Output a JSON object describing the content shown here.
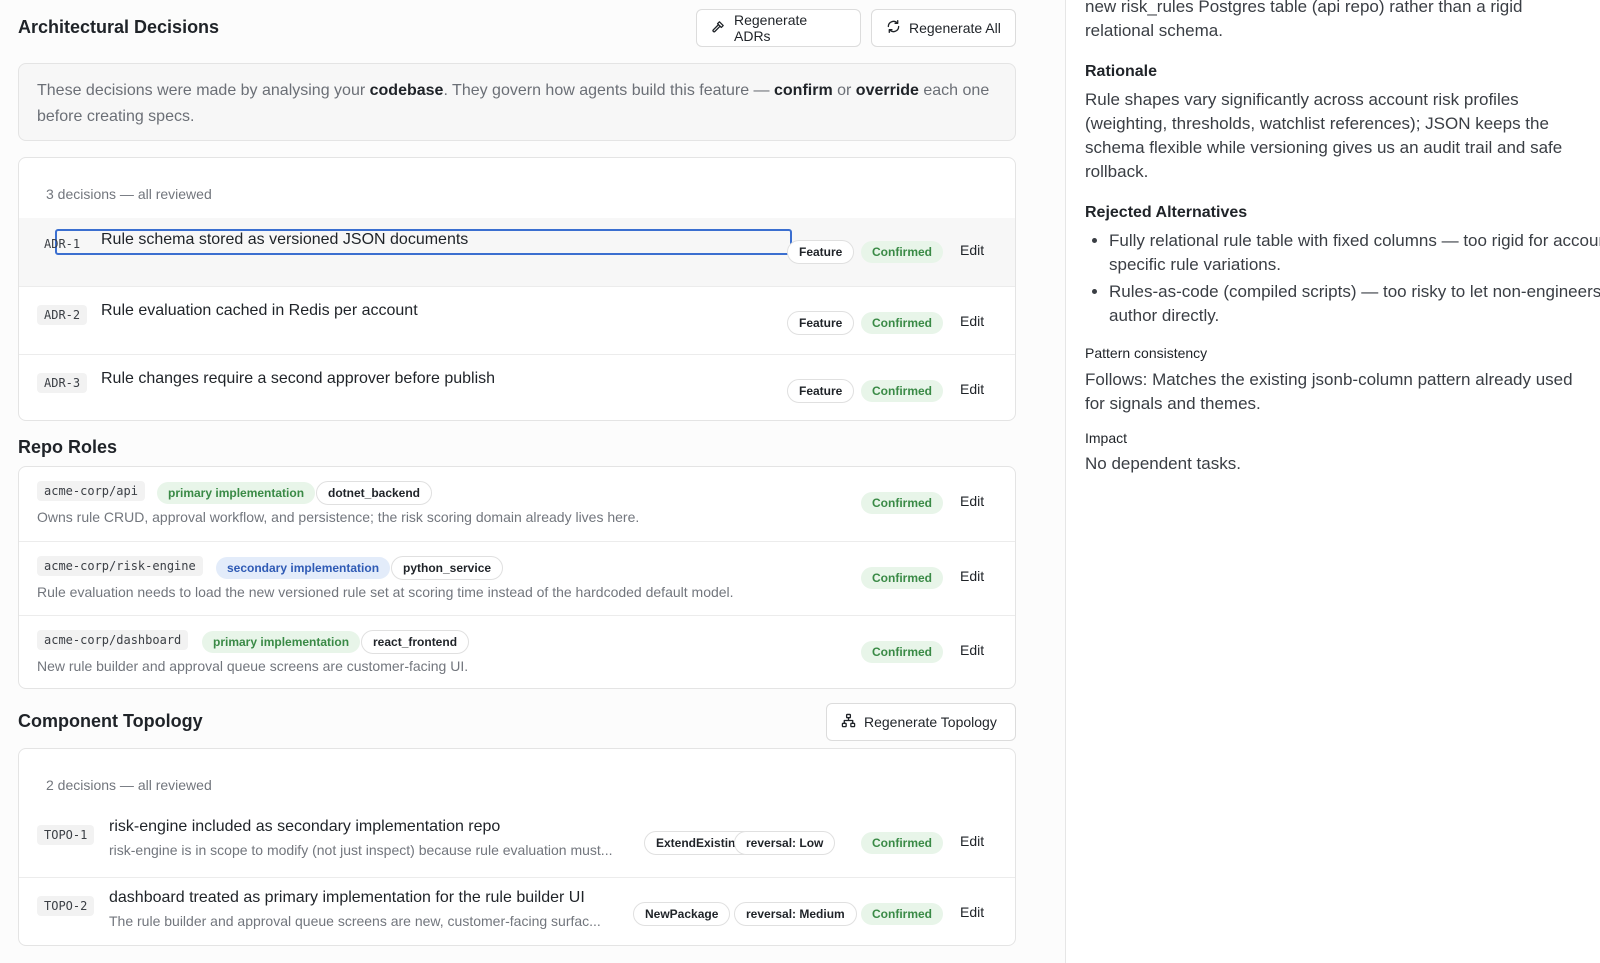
{
  "main": {
    "adr_section": {
      "title": "Architectural Decisions",
      "regen_adrs_label": "Regenerate ADRs",
      "regen_all_label": "Regenerate All",
      "info": {
        "t1": "These decisions were made by analysing your ",
        "b1": "codebase",
        "t2": ". They govern how agents build this feature — ",
        "b2": "confirm",
        "t3": " or ",
        "b3": "override",
        "t4": " each one before creating specs."
      },
      "count_text": "3 decisions — all reviewed",
      "rows": [
        {
          "id": "ADR-1",
          "title": "Rule schema stored as versioned JSON documents",
          "tag": "Feature",
          "status": "Confirmed",
          "edit": "Edit"
        },
        {
          "id": "ADR-2",
          "title": "Rule evaluation cached in Redis per account",
          "tag": "Feature",
          "status": "Confirmed",
          "edit": "Edit"
        },
        {
          "id": "ADR-3",
          "title": "Rule changes require a second approver before publish",
          "tag": "Feature",
          "status": "Confirmed",
          "edit": "Edit"
        }
      ]
    },
    "repo_section": {
      "title": "Repo Roles",
      "rows": [
        {
          "repo": "acme-corp/api",
          "role": "primary implementation",
          "stack": "dotnet_backend",
          "desc": "Owns rule CRUD, approval workflow, and persistence; the risk scoring domain already lives here.",
          "status": "Confirmed",
          "edit": "Edit"
        },
        {
          "repo": "acme-corp/risk-engine",
          "role": "secondary implementation",
          "stack": "python_service",
          "desc": "Rule evaluation needs to load the new versioned rule set at scoring time instead of the hardcoded default model.",
          "status": "Confirmed",
          "edit": "Edit"
        },
        {
          "repo": "acme-corp/dashboard",
          "role": "primary implementation",
          "stack": "react_frontend",
          "desc": "New rule builder and approval queue screens are customer-facing UI.",
          "status": "Confirmed",
          "edit": "Edit"
        }
      ]
    },
    "topology_section": {
      "title": "Component Topology",
      "regen_label": "Regenerate Topology",
      "count_text": "2 decisions — all reviewed",
      "rows": [
        {
          "id": "TOPO-1",
          "title": "risk-engine included as secondary implementation repo",
          "sub": "risk-engine is in scope to modify (not just inspect) because rule evaluation must...",
          "kind": "ExtendExisting",
          "reversal": "reversal: Low",
          "status": "Confirmed",
          "edit": "Edit"
        },
        {
          "id": "TOPO-2",
          "title": "dashboard treated as primary implementation for the rule builder UI",
          "sub": "The rule builder and approval queue screens are new, customer-facing surfac...",
          "kind": "NewPackage",
          "reversal": "reversal: Medium",
          "status": "Confirmed",
          "edit": "Edit"
        }
      ]
    }
  },
  "side": {
    "intro_line1": "new risk_rules Postgres table (api repo) rather than a rigid",
    "intro_line2": "relational schema.",
    "rationale_heading": "Rationale",
    "rationale_text": "Rule shapes vary significantly across account risk profiles (weighting, thresholds, watchlist references); JSON keeps the schema flexible while versioning gives us an audit trail and safe rollback.",
    "rejected_heading": "Rejected Alternatives",
    "rejected_items": [
      "Fully relational rule table with fixed columns — too rigid for account-specific rule variations.",
      "Rules-as-code (compiled scripts) — too risky to let non-engineers author directly."
    ],
    "pattern_heading": "Pattern consistency",
    "pattern_text": "Follows: Matches the existing jsonb-column pattern already used for signals and themes.",
    "impact_heading": "Impact",
    "impact_text": "No dependent tasks."
  },
  "colors": {
    "confirmed_bg": "#e8f5e9",
    "confirmed_text": "#3a8a46",
    "secondary_bg": "#e3ecfa",
    "secondary_text": "#2f5bb5",
    "focus_border": "#3b6fd0"
  },
  "icons": {
    "regen_adrs": "hammer-icon",
    "regen_all": "refresh-icon",
    "regen_topology": "hierarchy-icon"
  }
}
